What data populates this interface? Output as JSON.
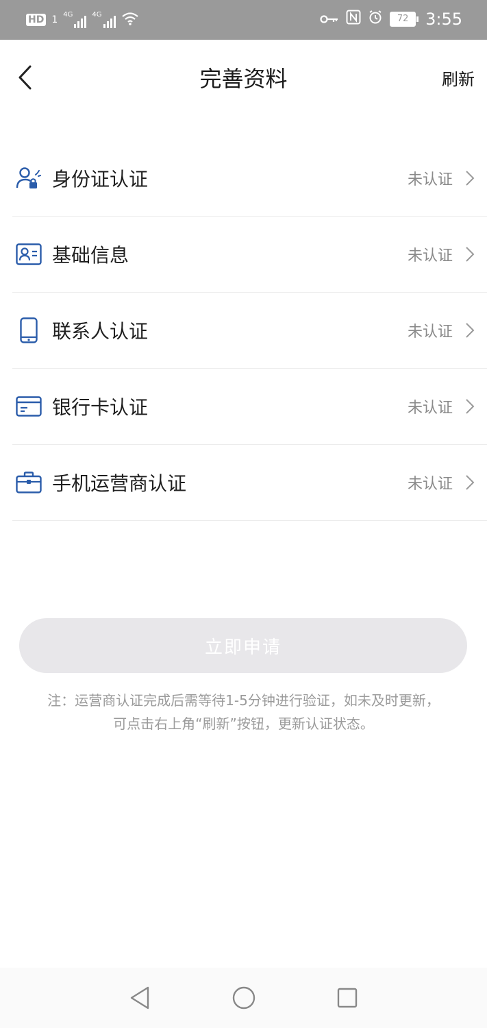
{
  "status_bar": {
    "hd": "HD",
    "sim1": "1",
    "net1": "4G",
    "net2": "4G",
    "battery": "72",
    "time": "3:55"
  },
  "header": {
    "title": "完善资料",
    "refresh": "刷新"
  },
  "items": [
    {
      "label": "身份证认证",
      "status": "未认证",
      "icon": "id-person-icon"
    },
    {
      "label": "基础信息",
      "status": "未认证",
      "icon": "profile-card-icon"
    },
    {
      "label": "联系人认证",
      "status": "未认证",
      "icon": "phone-icon"
    },
    {
      "label": "银行卡认证",
      "status": "未认证",
      "icon": "bank-card-icon"
    },
    {
      "label": "手机运营商认证",
      "status": "未认证",
      "icon": "briefcase-icon"
    }
  ],
  "apply_button": "立即申请",
  "note_line1": "注：运营商认证完成后需等待1-5分钟进行验证，如未及时更新，",
  "note_line2": "可点击右上角“刷新”按钮，更新认证状态。",
  "colors": {
    "accent": "#2a5caa",
    "status_bar_bg": "#9a9a9a",
    "button_disabled": "#e8e7ea"
  }
}
